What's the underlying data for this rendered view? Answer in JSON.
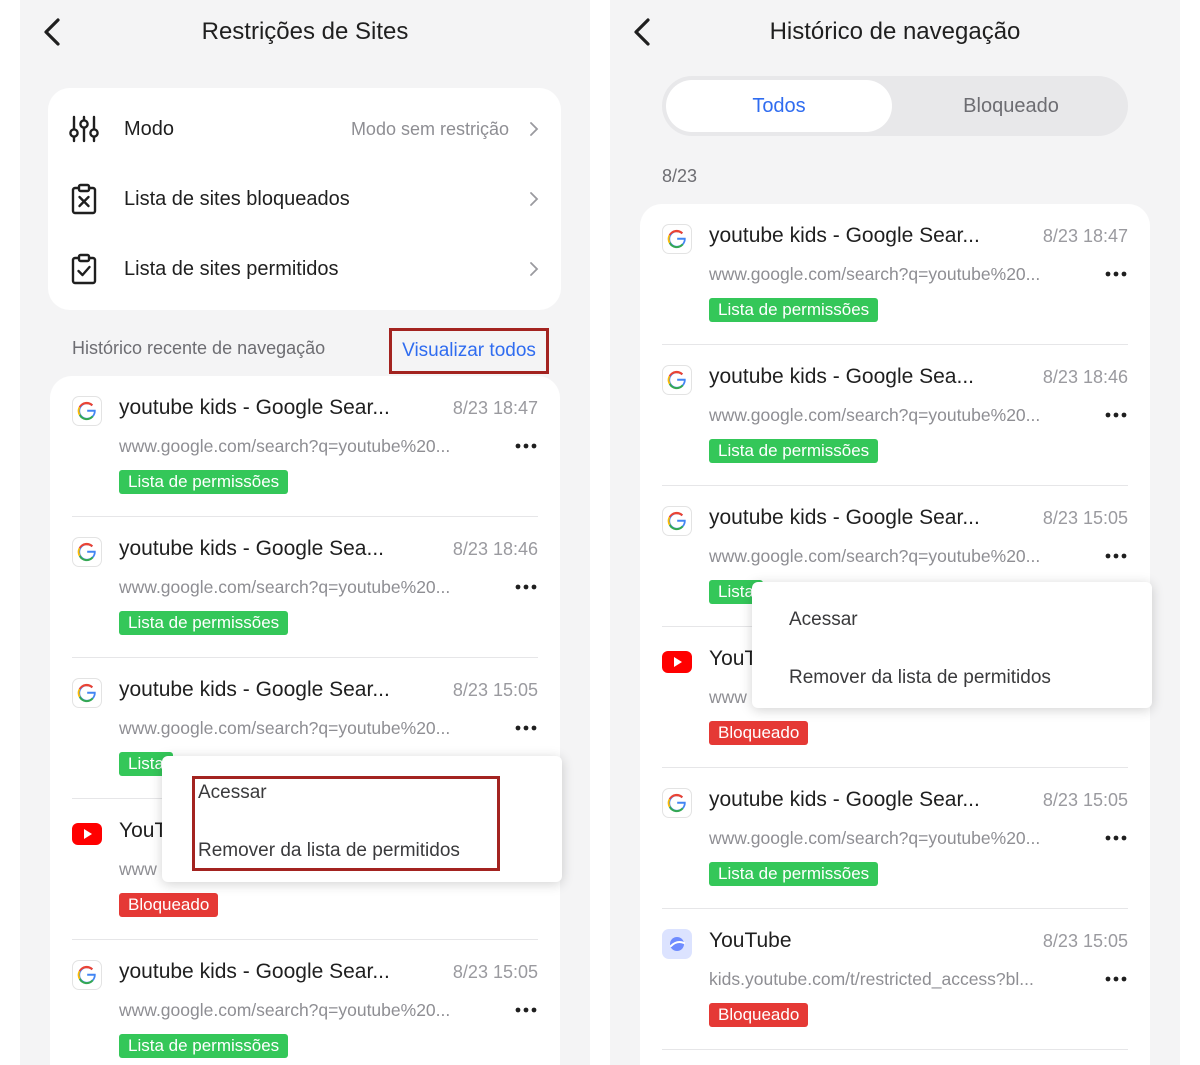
{
  "left": {
    "title": "Restrições de Sites",
    "settings": [
      {
        "label": "Modo",
        "value": "Modo sem restrição",
        "icon": "sliders-icon"
      },
      {
        "label": "Lista de sites bloqueados",
        "value": "",
        "icon": "clipboard-x-icon"
      },
      {
        "label": "Lista de sites permitidos",
        "value": "",
        "icon": "clipboard-check-icon"
      }
    ],
    "recent_label": "Histórico recente de navegação",
    "view_all": "Visualizar todos",
    "items": [
      {
        "title": "youtube kids - Google Sear...",
        "time": "8/23 18:47",
        "url": "www.google.com/search?q=youtube%20...",
        "badge": "Lista de permissões",
        "icon": "google-icon"
      },
      {
        "title": "youtube kids - Google Sea...",
        "time": "8/23 18:46",
        "url": "www.google.com/search?q=youtube%20...",
        "badge": "Lista de permissões",
        "icon": "google-icon"
      },
      {
        "title": "youtube kids - Google Sear...",
        "time": "8/23 15:05",
        "url": "www.google.com/search?q=youtube%20...",
        "badge": "Lista",
        "icon": "google-icon"
      },
      {
        "title": "YouT",
        "time": "",
        "url": "www",
        "badge": "Bloqueado",
        "icon": "youtube-icon"
      },
      {
        "title": "youtube kids - Google Sear...",
        "time": "8/23 15:05",
        "url": "www.google.com/search?q=youtube%20...",
        "badge": "Lista de permissões",
        "icon": "google-icon"
      }
    ],
    "menu": {
      "access": "Acessar",
      "remove": "Remover da lista de permitidos"
    }
  },
  "right": {
    "title": "Histórico de navegação",
    "tabs": {
      "all": "Todos",
      "blocked": "Bloqueado"
    },
    "date": "8/23",
    "items": [
      {
        "title": "youtube kids - Google Sear...",
        "time": "8/23 18:47",
        "url": "www.google.com/search?q=youtube%20...",
        "badge": "Lista de permissões",
        "icon": "google-icon"
      },
      {
        "title": "youtube kids - Google Sea...",
        "time": "8/23 18:46",
        "url": "www.google.com/search?q=youtube%20...",
        "badge": "Lista de permissões",
        "icon": "google-icon"
      },
      {
        "title": "youtube kids - Google Sear...",
        "time": "8/23 15:05",
        "url": "www.google.com/search?q=youtube%20...",
        "badge": "Lista",
        "icon": "google-icon"
      },
      {
        "title": "YouT",
        "time": "",
        "url": "www",
        "badge": "Bloqueado",
        "icon": "youtube-icon"
      },
      {
        "title": "youtube kids - Google Sear...",
        "time": "8/23 15:05",
        "url": "www.google.com/search?q=youtube%20...",
        "badge": "Lista de permissões",
        "icon": "google-icon"
      },
      {
        "title": "YouTube",
        "time": "8/23 15:05",
        "url": "kids.youtube.com/t/restricted_access?bl...",
        "badge": "Bloqueado",
        "icon": "youtube-kids-icon"
      }
    ],
    "menu": {
      "access": "Acessar",
      "remove": "Remover da lista de permitidos"
    }
  },
  "colors": {
    "accent": "#2f6cf0",
    "allowed": "#34c759",
    "blocked": "#e53935",
    "highlight": "#a32320"
  }
}
